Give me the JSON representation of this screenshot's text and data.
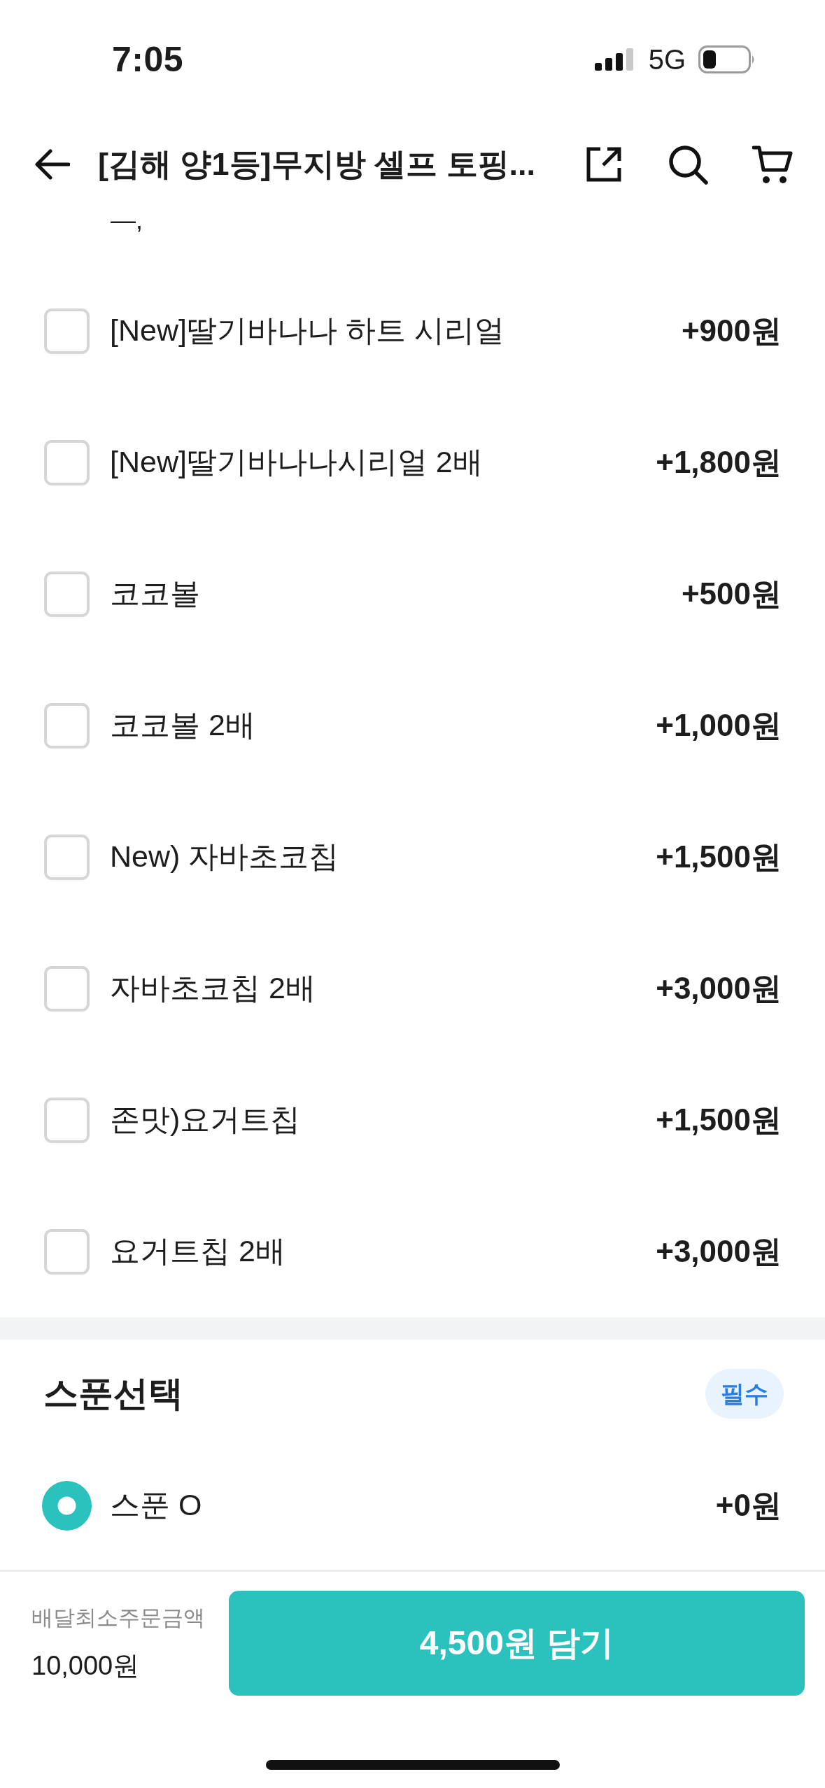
{
  "status_bar": {
    "time": "7:05",
    "network": "5G"
  },
  "header": {
    "title": "[김해 양1등]무지방 셀프 토핑..."
  },
  "clipped_text": "—,",
  "options": [
    {
      "label": "[New]딸기바나나 하트 시리얼",
      "price": "+900원",
      "checked": false
    },
    {
      "label": "[New]딸기바나나시리얼 2배",
      "price": "+1,800원",
      "checked": false
    },
    {
      "label": "코코볼",
      "price": "+500원",
      "checked": false
    },
    {
      "label": "코코볼 2배",
      "price": "+1,000원",
      "checked": false
    },
    {
      "label": "New) 자바초코칩",
      "price": "+1,500원",
      "checked": false
    },
    {
      "label": "자바초코칩 2배",
      "price": "+3,000원",
      "checked": false
    },
    {
      "label": "존맛)요거트칩",
      "price": "+1,500원",
      "checked": false
    },
    {
      "label": "요거트칩 2배",
      "price": "+3,000원",
      "checked": false
    }
  ],
  "spoon_section": {
    "title": "스푼선택",
    "badge": "필수",
    "options": [
      {
        "label": "스푼 O",
        "price": "+0원",
        "selected": true
      }
    ]
  },
  "footer": {
    "min_order_label": "배달최소주문금액",
    "min_order_amount": "10,000원",
    "add_button": "4,500원 담기"
  }
}
